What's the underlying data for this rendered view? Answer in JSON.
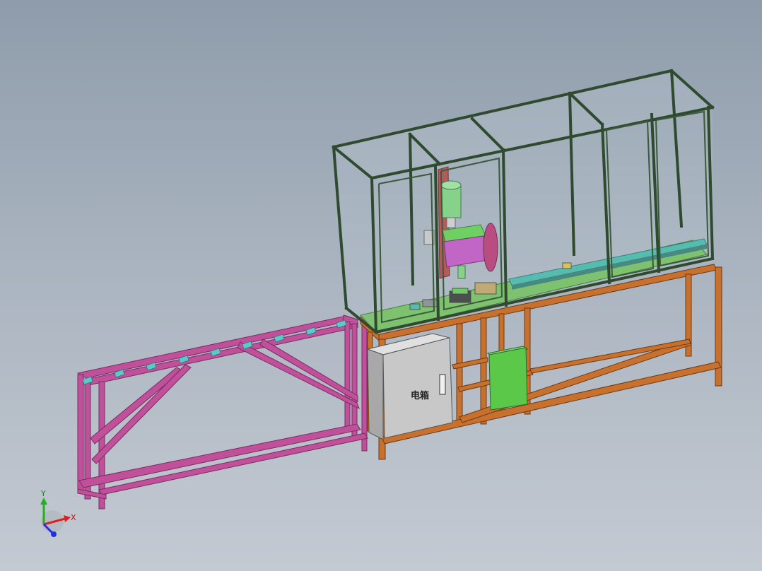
{
  "viewport": {
    "background_top": "#8e9cab",
    "background_bottom": "#c4cad2"
  },
  "model": {
    "electrical_box_label": "电箱",
    "colors": {
      "conveyor_frame": "#c0509a",
      "conveyor_rollers": "#5fc8c8",
      "base_frame": "#c8702e",
      "enclosure_frame": "#2f4a2f",
      "enclosure_glass": "#b9c8d2",
      "work_plate": "#6fbf5a",
      "rail": "#3fb8a8",
      "cylinder": "#7ad27a",
      "spindle_housing": "#c24fc2",
      "saw_blade": "#b8306e",
      "motor_box": "#5cc84a",
      "electrical_box": "#c8c8c8"
    }
  },
  "triad": {
    "x_label": "X",
    "y_label": "Y",
    "x_color": "#e02020",
    "y_color": "#20b020",
    "z_color": "#2030e0"
  }
}
